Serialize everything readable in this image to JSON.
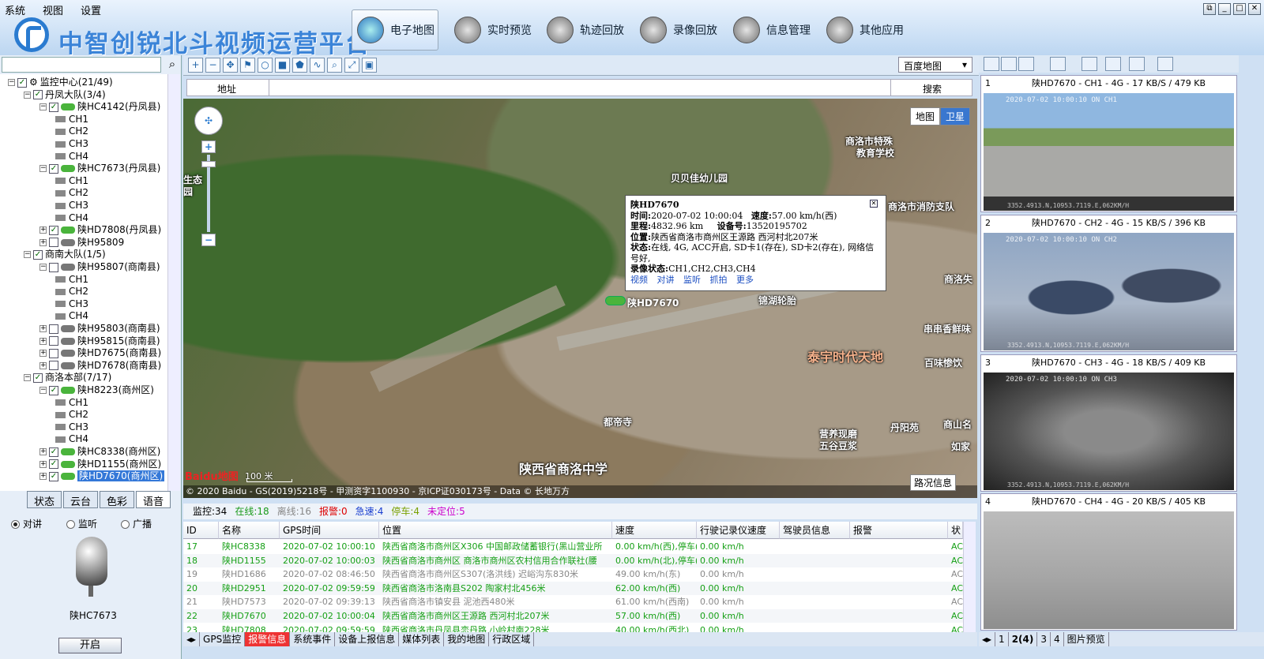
{
  "menu": [
    "系统",
    "视图",
    "设置"
  ],
  "brand": "中智创锐北斗视频运营平台",
  "nav": [
    {
      "label": "电子地图"
    },
    {
      "label": "实时预览"
    },
    {
      "label": "轨迹回放"
    },
    {
      "label": "录像回放"
    },
    {
      "label": "信息管理"
    },
    {
      "label": "其他应用"
    }
  ],
  "tree": [
    {
      "label": "监控中心(21/49)",
      "level": 0,
      "type": "root"
    },
    {
      "label": "丹凤大队(3/4)",
      "level": 1,
      "type": "group"
    },
    {
      "label": "陕HC4142(丹凤县)",
      "level": 2,
      "type": "veh",
      "online": true
    },
    {
      "label": "CH1",
      "level": 3,
      "type": "ch"
    },
    {
      "label": "CH2",
      "level": 3,
      "type": "ch"
    },
    {
      "label": "CH3",
      "level": 3,
      "type": "ch"
    },
    {
      "label": "CH4",
      "level": 3,
      "type": "ch"
    },
    {
      "label": "陕HC7673(丹凤县)",
      "level": 2,
      "type": "veh",
      "online": true
    },
    {
      "label": "CH1",
      "level": 3,
      "type": "ch"
    },
    {
      "label": "CH2",
      "level": 3,
      "type": "ch"
    },
    {
      "label": "CH3",
      "level": 3,
      "type": "ch"
    },
    {
      "label": "CH4",
      "level": 3,
      "type": "ch"
    },
    {
      "label": "陕HD7808(丹凤县)",
      "level": 2,
      "type": "veh",
      "online": true
    },
    {
      "label": "陕H95809",
      "level": 2,
      "type": "veh",
      "online": false
    },
    {
      "label": "商南大队(1/5)",
      "level": 1,
      "type": "group"
    },
    {
      "label": "陕H95807(商南县)",
      "level": 2,
      "type": "veh",
      "online": false
    },
    {
      "label": "CH1",
      "level": 3,
      "type": "ch"
    },
    {
      "label": "CH2",
      "level": 3,
      "type": "ch"
    },
    {
      "label": "CH3",
      "level": 3,
      "type": "ch"
    },
    {
      "label": "CH4",
      "level": 3,
      "type": "ch"
    },
    {
      "label": "陕H95803(商南县)",
      "level": 2,
      "type": "veh",
      "online": false
    },
    {
      "label": "陕H95815(商南县)",
      "level": 2,
      "type": "veh",
      "online": false
    },
    {
      "label": "陕HD7675(商南县)",
      "level": 2,
      "type": "veh",
      "online": false
    },
    {
      "label": "陕HD7678(商南县)",
      "level": 2,
      "type": "veh",
      "online": false
    },
    {
      "label": "商洛本部(7/17)",
      "level": 1,
      "type": "group"
    },
    {
      "label": "陕H8223(商州区)",
      "level": 2,
      "type": "veh",
      "online": true
    },
    {
      "label": "CH1",
      "level": 3,
      "type": "ch"
    },
    {
      "label": "CH2",
      "level": 3,
      "type": "ch"
    },
    {
      "label": "CH3",
      "level": 3,
      "type": "ch"
    },
    {
      "label": "CH4",
      "level": 3,
      "type": "ch"
    },
    {
      "label": "陕HC8338(商州区)",
      "level": 2,
      "type": "veh",
      "online": true
    },
    {
      "label": "陕HD1155(商州区)",
      "level": 2,
      "type": "veh",
      "online": true
    },
    {
      "label": "陕HD7670(商州区)",
      "level": 2,
      "type": "veh",
      "online": true,
      "selected": true
    }
  ],
  "lefttabs": [
    "状态",
    "云台",
    "色彩",
    "语音"
  ],
  "intercom": {
    "modes": [
      "对讲",
      "监听",
      "广播"
    ],
    "device": "陕HC7673",
    "open": "开启"
  },
  "maptype_select": "百度地图",
  "address": {
    "label": "地址",
    "search": "搜索"
  },
  "maptype": [
    "地图",
    "卫星"
  ],
  "map_labels": [
    {
      "text": "商洛市特殊",
      "big": false
    },
    {
      "text": "教育学校",
      "big": false
    },
    {
      "text": "贝贝佳幼儿园",
      "big": false
    },
    {
      "text": "商洛市消防支队",
      "big": false
    },
    {
      "text": "锦湖轮胎",
      "big": false
    },
    {
      "text": "商洛失",
      "big": false
    },
    {
      "text": "串串香鲜味",
      "big": false
    },
    {
      "text": "泰宇时代天地",
      "big": true
    },
    {
      "text": "百味惨饮",
      "big": false
    },
    {
      "text": "都帝寺",
      "big": false
    },
    {
      "text": "营养现磨",
      "big": false
    },
    {
      "text": "五谷豆浆",
      "big": false
    },
    {
      "text": "丹阳苑",
      "big": false
    },
    {
      "text": "商山名",
      "big": false
    },
    {
      "text": "如家",
      "big": false
    },
    {
      "text": "陕西省商洛中学",
      "big": true
    },
    {
      "text": "生态",
      "big": false
    },
    {
      "text": "园",
      "big": false
    }
  ],
  "popup": {
    "title": "陕HD7670",
    "time_label": "时间:",
    "time": "2020-07-02 10:00:04",
    "speed_label": "速度:",
    "speed": "57.00 km/h(西)",
    "mileage_label": "里程:",
    "mileage": "4832.96 km",
    "device_label": "设备号:",
    "device": "13520195702",
    "pos_label": "位置:",
    "pos": "陕西省商洛市商州区王源路 西河村北207米",
    "status_label": "状态:",
    "status": "在线, 4G, ACC开启, SD卡1(存在), SD卡2(存在), 网络信号好,",
    "rec_label": "录像状态:",
    "rec": "CH1,CH2,CH3,CH4",
    "links": [
      "视频",
      "对讲",
      "监听",
      "抓拍",
      "更多"
    ]
  },
  "vehicle_label": "陕HD7670",
  "baidu": "Baidu地图",
  "scale": "100 米",
  "copyright": "© 2020 Baidu - GS(2019)5218号 - 甲测资字1100930 - 京ICP证030173号 - Data © 长地万方",
  "roadinfo": "路况信息",
  "stats": [
    {
      "text": "监控:34",
      "color": "#000"
    },
    {
      "text": "在线:18",
      "color": "#1a9a1a"
    },
    {
      "text": "离线:16",
      "color": "#888"
    },
    {
      "text": "报警:0",
      "color": "#d00"
    },
    {
      "text": "急速:4",
      "color": "#1a3fd0"
    },
    {
      "text": "停车:4",
      "color": "#7aa000"
    },
    {
      "text": "未定位:5",
      "color": "#c0c"
    }
  ],
  "table": {
    "headers": [
      "ID",
      "名称",
      "GPS时间",
      "位置",
      "速度",
      "行驶记录仪速度",
      "驾驶员信息",
      "报警",
      "状"
    ],
    "rows": [
      {
        "c": [
          "17",
          "陕HC8338",
          "2020-07-02 10:00:10",
          "陕西省商洛市商州区X306 中国邮政储蓄银行(黑山营业所",
          "0.00 km/h(西),停车(0",
          "0.00 km/h",
          "",
          "",
          "ACC"
        ],
        "color": "#16a016"
      },
      {
        "c": [
          "18",
          "陕HD1155",
          "2020-07-02 10:00:03",
          "陕西省商洛市商州区 商洛市商州区农村信用合作联社(腰",
          "0.00 km/h(北),停车(0",
          "0.00 km/h",
          "",
          "",
          "ACC"
        ],
        "color": "#16a016"
      },
      {
        "c": [
          "19",
          "陕HD1686",
          "2020-07-02 08:46:50",
          "陕西省商洛市商州区S307(洛洪线) 迟峪沟东830米",
          "49.00 km/h(东)",
          "0.00 km/h",
          "",
          "",
          "ACC"
        ],
        "color": "#888"
      },
      {
        "c": [
          "20",
          "陕HD2951",
          "2020-07-02 09:59:59",
          "陕西省商洛市洛南县S202 陶家村北456米",
          "62.00 km/h(西)",
          "0.00 km/h",
          "",
          "",
          "ACC"
        ],
        "color": "#16a016"
      },
      {
        "c": [
          "21",
          "陕HD7573",
          "2020-07-02 09:39:13",
          "陕西省商洛市镇安县 泥池西480米",
          "61.00 km/h(西南)",
          "0.00 km/h",
          "",
          "",
          "ACC"
        ],
        "color": "#888"
      },
      {
        "c": [
          "22",
          "陕HD7670",
          "2020-07-02 10:00:04",
          "陕西省商洛市商州区王源路 西河村北207米",
          "57.00 km/h(西)",
          "0.00 km/h",
          "",
          "",
          "ACC"
        ],
        "color": "#16a016"
      },
      {
        "c": [
          "23",
          "陕HD7808",
          "2020-07-02 09:59:59",
          "陕西省商洛市丹凤县恋丹路 小岭村南228米",
          "40.00 km/h(西北)",
          "0.00 km/h",
          "",
          "",
          "ACC"
        ],
        "color": "#16a016"
      }
    ]
  },
  "bottom_tabs": [
    "GPS监控",
    "报警信息",
    "系统事件",
    "设备上报信息",
    "媒体列表",
    "我的地图",
    "行政区域"
  ],
  "videos": [
    {
      "num": "1",
      "title": "陕HD7670 - CH1 - 4G - 17 KB/S / 479 KB",
      "ts": "2020-07-02 10:00:10 ON  CH1",
      "coord": "3352.4913.N,10953.7119.E,062KM/H"
    },
    {
      "num": "2",
      "title": "陕HD7670 - CH2 - 4G - 15 KB/S / 396 KB",
      "ts": "2020-07-02 10:00:10 ON  CH2",
      "coord": "3352.4913.N,10953.7119.E,062KM/H"
    },
    {
      "num": "3",
      "title": "陕HD7670 - CH3 - 4G - 18 KB/S / 409 KB",
      "ts": "2020-07-02 10:00:10 ON  CH3",
      "coord": "3352.4913.N,10953.7119.E,062KM/H"
    },
    {
      "num": "4",
      "title": "陕HD7670 - CH4 - 4G - 20 KB/S / 405 KB",
      "ts": "",
      "coord": ""
    }
  ],
  "right_tabs": [
    "1",
    "2(4)",
    "3",
    "4",
    "图片预览"
  ]
}
